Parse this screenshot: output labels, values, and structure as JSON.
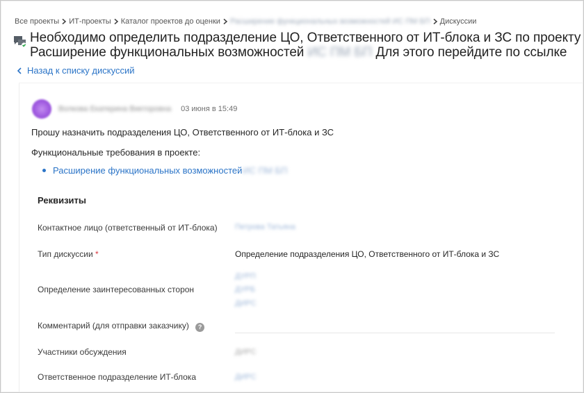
{
  "breadcrumb": [
    {
      "label": "Все проекты",
      "blurred": false
    },
    {
      "label": "ИТ-проекты",
      "blurred": false
    },
    {
      "label": "Каталог проектов до оценки",
      "blurred": false
    },
    {
      "label": "Расширение функциональных возможностей ИС ПМ БП",
      "blurred": true
    },
    {
      "label": "Дискуссии",
      "blurred": false
    }
  ],
  "title": {
    "line1": "Необходимо определить подразделение ЦО, Ответственного от ИТ-блока и ЗС по проекту",
    "line2_a": "Расширение функциональных возможностей",
    "line2_blur": "ИС ПМ БП",
    "line2_b": "Для этого перейдите по ссылке"
  },
  "back_link": "Назад к списку дискуссий",
  "message": {
    "author": "Волкова Екатерина Викторовна",
    "date": "03 июня в 15:49",
    "text1": "Прошу назначить подразделения ЦО, Ответственного от ИТ-блока и ЗС",
    "text2": "Функциональные требования в проекте:",
    "list_item": "Расширение функциональных возможностей",
    "list_item_blur": "ИС ПМ БП"
  },
  "requisites": {
    "title": "Реквизиты",
    "contact_label": "Контактное лицо (ответственный от ИТ-блока)",
    "contact_value": "Петрова Татьяна",
    "type_label": "Тип дискуссии",
    "type_required": "*",
    "type_value": "Определение подразделения ЦО, Ответственного от ИТ-блока и ЗС",
    "stakeholders_label": "Определение заинтересованных сторон",
    "stakeholders": [
      "ДУРП",
      "ДУРБ",
      "ДИРС"
    ],
    "comment_label": "Комментарий (для отправки заказчику)",
    "participants_label": "Участники обсуждения",
    "participants_value": "ДИРС",
    "responsible_label": "Ответственное подразделение ИТ-блока",
    "responsible_value": "ДИРС"
  },
  "colors": {
    "link": "#2b74c7",
    "required": "#d9363e",
    "avatar": "#a05ae0"
  }
}
